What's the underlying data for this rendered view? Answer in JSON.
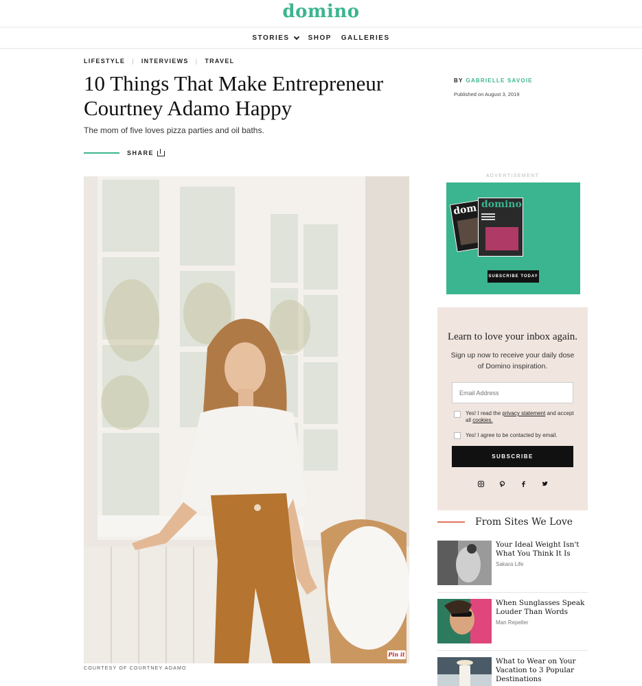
{
  "site": {
    "logo": "domino"
  },
  "nav": {
    "items": [
      "STORIES",
      "SHOP",
      "GALLERIES"
    ]
  },
  "article": {
    "categories": [
      "LIFESTYLE",
      "INTERVIEWS",
      "TRAVEL"
    ],
    "title": "10 Things That Make Entrepreneur Courtney Adamo Happy",
    "dek": "The mom of five loves pizza parties and oil baths.",
    "share_label": "SHARE",
    "by_label": "BY",
    "author": "GABRIELLE SAVOIE",
    "published": "Published on August 3, 2019",
    "photo_credit": "COURTESY OF COURTNEY ADAMO",
    "pin_label": "Pin it"
  },
  "ad": {
    "label": "ADVERTISEMENT",
    "mag_front": "domino",
    "mag_back": "dom",
    "cta": "SUBSCRIBE TODAY"
  },
  "newsletter": {
    "heading": "Learn to love your inbox again.",
    "subtext": "Sign up now to receive your daily dose of Domino inspiration.",
    "email_placeholder": "Email Address",
    "consent1_pre": "Yes! I read the",
    "consent1_link1": "privacy statement",
    "consent1_mid": "and accept all",
    "consent1_link2": "cookies.",
    "consent2": "Yes! I agree to be contacted by email.",
    "button": "SUBSCRIBE",
    "social_icons": [
      "instagram-icon",
      "pinterest-icon",
      "facebook-icon",
      "twitter-icon"
    ]
  },
  "from_sites": {
    "heading": "From Sites We Love",
    "stories": [
      {
        "title": "Your Ideal Weight Isn't What You Think It Is",
        "source": "Sakara Life"
      },
      {
        "title": "When Sunglasses Speak Louder Than Words",
        "source": "Man Repeller"
      },
      {
        "title": "What to Wear on Your Vacation to 3 Popular Destinations",
        "source": ""
      }
    ]
  }
}
